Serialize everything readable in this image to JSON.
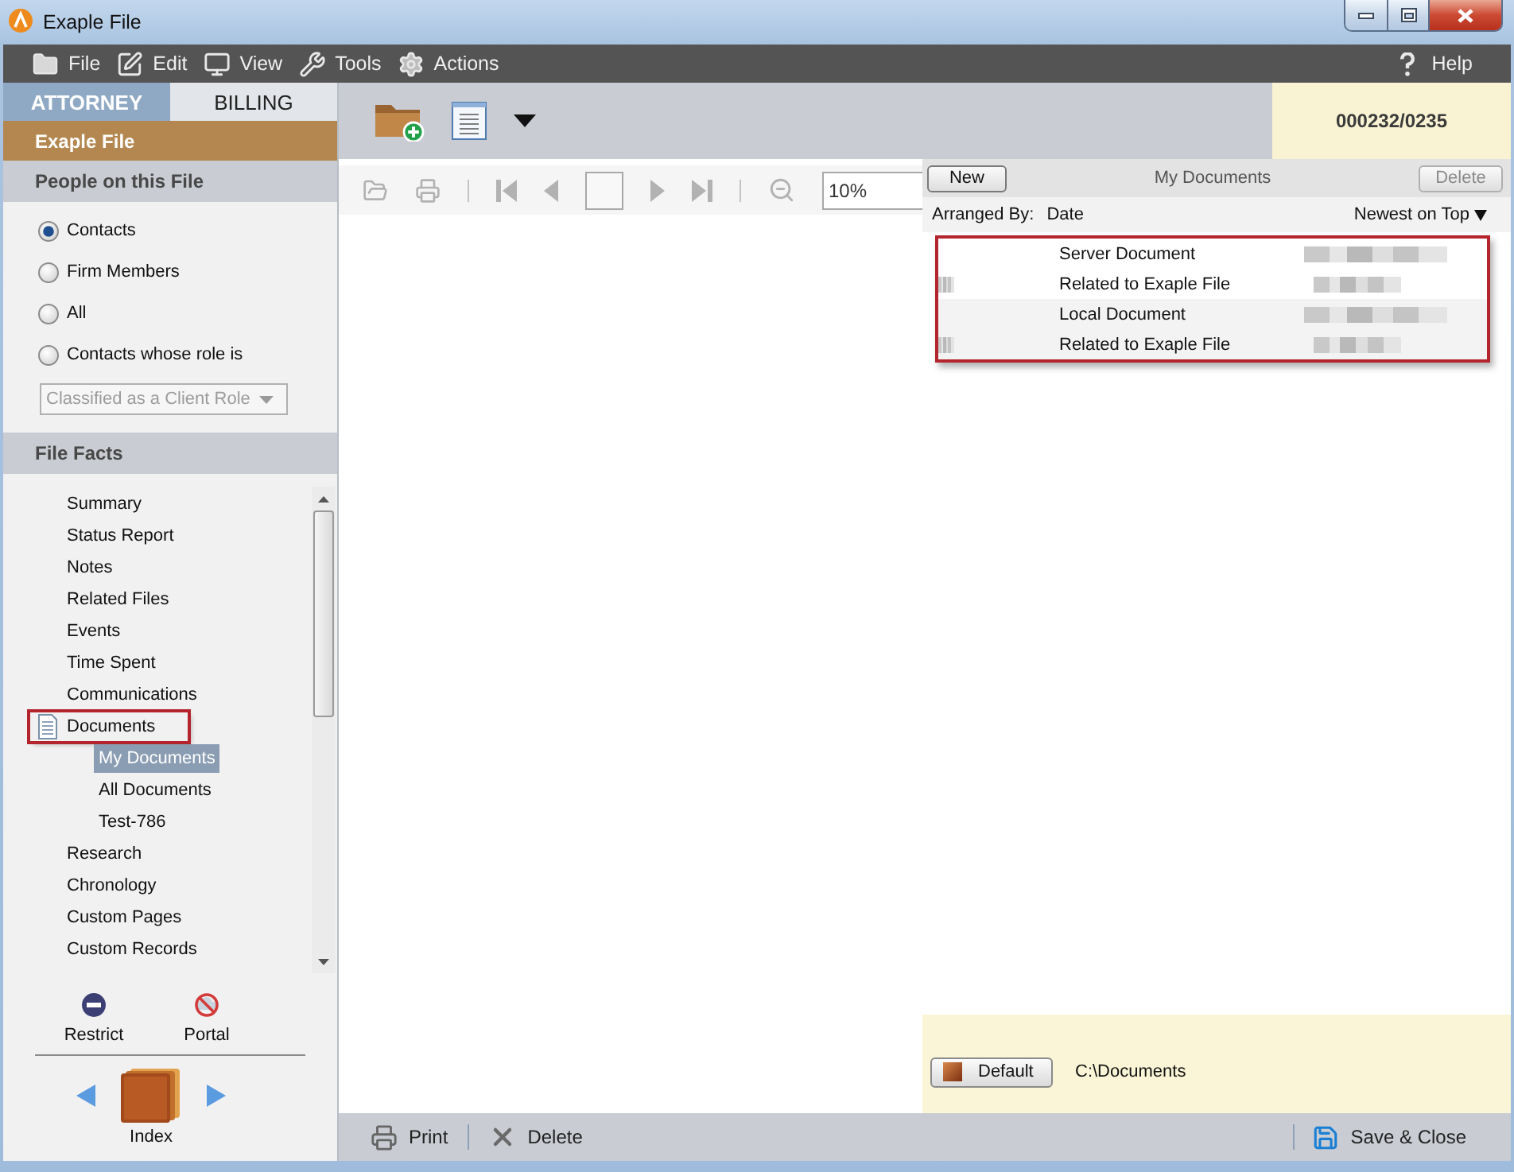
{
  "window": {
    "title": "Exaple File"
  },
  "menu": {
    "items": [
      {
        "label": "File"
      },
      {
        "label": "Edit"
      },
      {
        "label": "View"
      },
      {
        "label": "Tools"
      },
      {
        "label": "Actions"
      }
    ],
    "help": "Help"
  },
  "tabs": [
    {
      "label": "ATTORNEY",
      "selected": true
    },
    {
      "label": "BILLING",
      "selected": false
    }
  ],
  "file_title": "Exaple File",
  "people": {
    "title": "People on this File",
    "options": [
      {
        "label": "Contacts",
        "selected": true
      },
      {
        "label": "Firm Members",
        "selected": false
      },
      {
        "label": "All",
        "selected": false
      },
      {
        "label": "Contacts whose role is",
        "selected": false
      }
    ],
    "role_dropdown": {
      "value": "Classified as a Client Role",
      "disabled": true
    }
  },
  "file_facts": {
    "title": "File Facts",
    "items": [
      {
        "label": "Summary",
        "selected": false,
        "highlighted": false
      },
      {
        "label": "Status Report",
        "selected": false,
        "highlighted": false
      },
      {
        "label": "Notes",
        "selected": false,
        "highlighted": false
      },
      {
        "label": "Related Files",
        "selected": false,
        "highlighted": false
      },
      {
        "label": "Events",
        "selected": false,
        "highlighted": false
      },
      {
        "label": "Time Spent",
        "selected": false,
        "highlighted": false
      },
      {
        "label": "Communications",
        "selected": false,
        "highlighted": false
      },
      {
        "label": "Documents",
        "selected": false,
        "highlighted": true,
        "children": [
          {
            "label": "My Documents",
            "selected": true,
            "highlighted": false
          },
          {
            "label": "All Documents",
            "selected": false,
            "highlighted": false
          },
          {
            "label": "Test-786",
            "selected": false,
            "highlighted": false
          }
        ]
      },
      {
        "label": "Research",
        "selected": false,
        "highlighted": false
      },
      {
        "label": "Chronology",
        "selected": false,
        "highlighted": false
      },
      {
        "label": "Custom Pages",
        "selected": false,
        "highlighted": false
      },
      {
        "label": "Custom Records",
        "selected": false,
        "highlighted": false
      }
    ]
  },
  "side_actions": [
    {
      "label": "Restrict"
    },
    {
      "label": "Portal"
    }
  ],
  "index": {
    "label": "Index"
  },
  "file_number": "000232/0235",
  "viewer": {
    "zoom": "10%"
  },
  "documents_panel": {
    "new_button": {
      "label": "New",
      "disabled": false
    },
    "title": "My Documents",
    "delete_button": {
      "label": "Delete",
      "disabled": true
    },
    "arranged_by_label": "Arranged By:",
    "arranged_by": "Date",
    "sort": "Newest on Top",
    "highlighted": true,
    "items": [
      {
        "title": "Server Document",
        "subtitle": "Related to Exaple File"
      },
      {
        "title": "Local Document",
        "subtitle": "Related to Exaple File"
      }
    ]
  },
  "location": {
    "button": "Default",
    "path": "C:\\Documents"
  },
  "bottom_bar": {
    "actions": [
      {
        "label": "Print"
      },
      {
        "label": "Delete"
      }
    ],
    "save": "Save & Close"
  }
}
